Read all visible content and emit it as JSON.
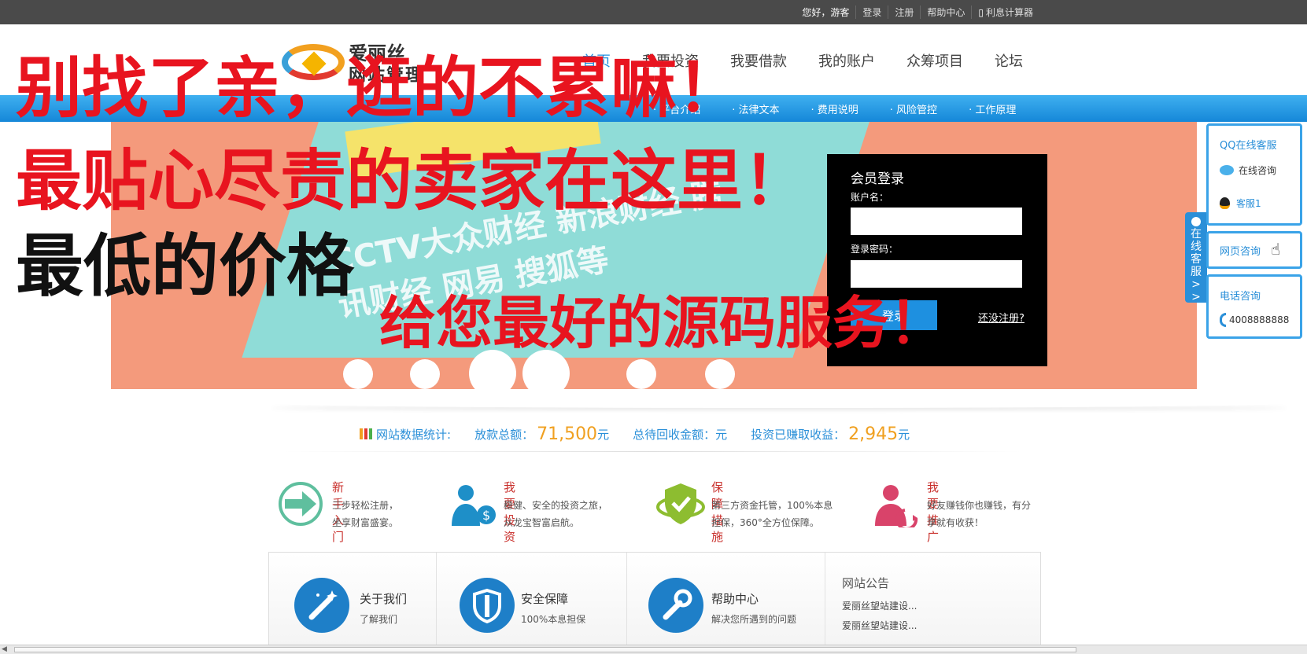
{
  "topbar": {
    "greeting": "您好，游客",
    "links": [
      "登录",
      "注册",
      "帮助中心",
      "利息计算器"
    ]
  },
  "logo": {
    "line1": "爱丽丝",
    "line2": "网站管理"
  },
  "nav": {
    "items": [
      "首页",
      "我要投资",
      "我要借款",
      "我的账户",
      "众筹项目",
      "论坛"
    ]
  },
  "subnav": {
    "items": [
      "· 平台介绍",
      "· 法律文本",
      "· 费用说明",
      "· 风险管控",
      "· 工作原理"
    ]
  },
  "banner": {
    "text": "CCTV大众财经  新浪财经  腾讯财经  网易  搜狐等"
  },
  "login": {
    "title": "会员登录",
    "account_label": "账户名：",
    "password_label": "登录密码：",
    "submit": "登录",
    "register": "还没注册?"
  },
  "overlay": {
    "line1": "别找了亲，逛的不累嘛！",
    "line2": "最贴心尽责的卖家在这里！",
    "line3": "最低的价格",
    "line4": "给您最好的源码服务！"
  },
  "side": {
    "qq_title": "QQ在线客服",
    "online": "在线咨询",
    "kefu": "客服1",
    "web": "网页咨询",
    "phone_title": "电话咨询",
    "phone": "4008888888",
    "tab": "在线客服>>"
  },
  "stats": {
    "title": "网站数据统计:",
    "loan_label": "放款总额：",
    "loan_value": "71,500",
    "unit": "元",
    "pending_label": "总待回收金额：元",
    "earned_label": "投资已赚取收益：",
    "earned_value": "2,945"
  },
  "features": [
    {
      "title": "新手入门",
      "desc1": "三步轻松注册，",
      "desc2": "坐享财富盛宴。"
    },
    {
      "title": "我要投资",
      "desc1": "稳健、安全的投资之旅，",
      "desc2": "从龙宝智富启航。"
    },
    {
      "title": "保障措施",
      "desc1": "第三方资金托管，100%本息",
      "desc2": "担保，360°全方位保障。"
    },
    {
      "title": "我要推广",
      "desc1": "好友赚钱你也赚钱，有分",
      "desc2": "享就有收获！"
    }
  ],
  "bottom": {
    "about": {
      "title": "关于我们",
      "sub": "了解我们"
    },
    "security": {
      "title": "安全保障",
      "sub": "100%本息担保"
    },
    "help": {
      "title": "帮助中心",
      "sub": "解决您所遇到的问题"
    },
    "notice": {
      "title": "网站公告",
      "items": [
        "爱丽丝望站建设...",
        "爱丽丝望站建设..."
      ]
    }
  }
}
